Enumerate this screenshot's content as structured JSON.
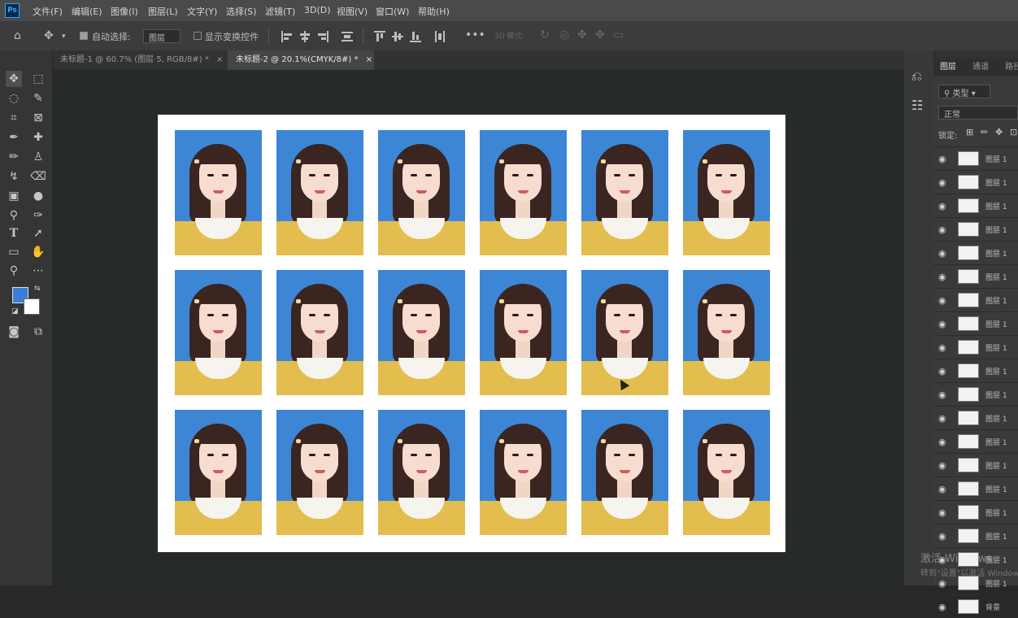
{
  "app": {
    "logo": "Ps"
  },
  "menu": [
    "文件(F)",
    "编辑(E)",
    "图像(I)",
    "图层(L)",
    "文字(Y)",
    "选择(S)",
    "滤镜(T)",
    "3D(D)",
    "视图(V)",
    "窗口(W)",
    "帮助(H)"
  ],
  "options": {
    "auto_select_label": "自动选择:",
    "auto_select_value": "图层",
    "show_transform_label": "显示变换控件",
    "mode_3d_label": "3D 模式:"
  },
  "tabs": [
    {
      "label": "未标题-1 @ 60.7% (图层 5, RGB/8#) *",
      "close": "×"
    },
    {
      "label": "未标题-2 @ 20.1%(CMYK/8#) *",
      "close": "×"
    }
  ],
  "colors": {
    "foreground": "#3a7fd5",
    "background": "#ffffff",
    "photo_bg": "#3d86d6",
    "canvas_area": "#272b28"
  },
  "photo_grid": {
    "rows": 3,
    "cols": 6
  },
  "panel": {
    "tabs": [
      "图层",
      "通道",
      "路径"
    ],
    "kind_filter": "类型",
    "blend_mode": "正常",
    "lock_label": "锁定:"
  },
  "layers": [
    {
      "name": "图层 1"
    },
    {
      "name": "图层 1"
    },
    {
      "name": "图层 1"
    },
    {
      "name": "图层 1"
    },
    {
      "name": "图层 1"
    },
    {
      "name": "图层 1"
    },
    {
      "name": "图层 1"
    },
    {
      "name": "图层 1"
    },
    {
      "name": "图层 1"
    },
    {
      "name": "图层 1"
    },
    {
      "name": "图层 1"
    },
    {
      "name": "图层 1"
    },
    {
      "name": "图层 1"
    },
    {
      "name": "图层 1"
    },
    {
      "name": "图层 1"
    },
    {
      "name": "图层 1"
    },
    {
      "name": "图层 1"
    },
    {
      "name": "图层 1"
    },
    {
      "name": "图层 1"
    },
    {
      "name": "背景"
    }
  ],
  "watermark": {
    "line1": "激活 Windows",
    "line2": "转到\"设置\"以激活 Windows。"
  }
}
